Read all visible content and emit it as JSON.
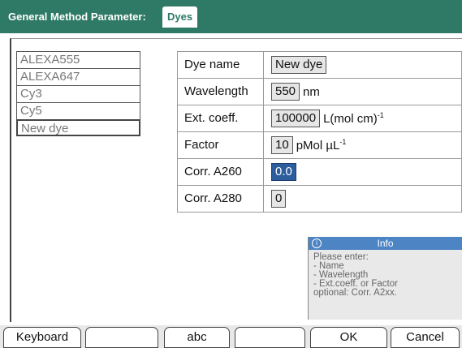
{
  "header": {
    "title": "General Method Parameter:",
    "tab": "Dyes"
  },
  "dye_list": [
    "ALEXA555",
    "ALEXA647",
    "Cy3",
    "Cy5",
    "New dye"
  ],
  "params": {
    "dye_name": {
      "label": "Dye name",
      "value": "New dye"
    },
    "wavelength": {
      "label": "Wavelength",
      "value": "550",
      "unit": "nm"
    },
    "ext_coeff": {
      "label": "Ext. coeff.",
      "value": "100000",
      "unit": "L(mol cm)",
      "unit_sup": "-1"
    },
    "factor": {
      "label": "Factor",
      "value": "10",
      "unit": "pMol µL",
      "unit_sup": "-1"
    },
    "corr_a260": {
      "label": "Corr. A260",
      "value": "0.0"
    },
    "corr_a280": {
      "label": "Corr. A280",
      "value": "0"
    }
  },
  "info": {
    "title": "Info",
    "icon": "info-icon",
    "lines": [
      "Please enter:",
      "- Name",
      "- Wavelength",
      "- Ext.coeff. or Factor",
      "optional: Corr. A2xx."
    ]
  },
  "softkeys": [
    "Keyboard",
    "",
    "abc",
    "",
    "OK",
    "Cancel"
  ],
  "colors": {
    "titlebar": "#2f7a66",
    "active_field": "#2d5d9c",
    "info_header": "#4d84c4"
  }
}
